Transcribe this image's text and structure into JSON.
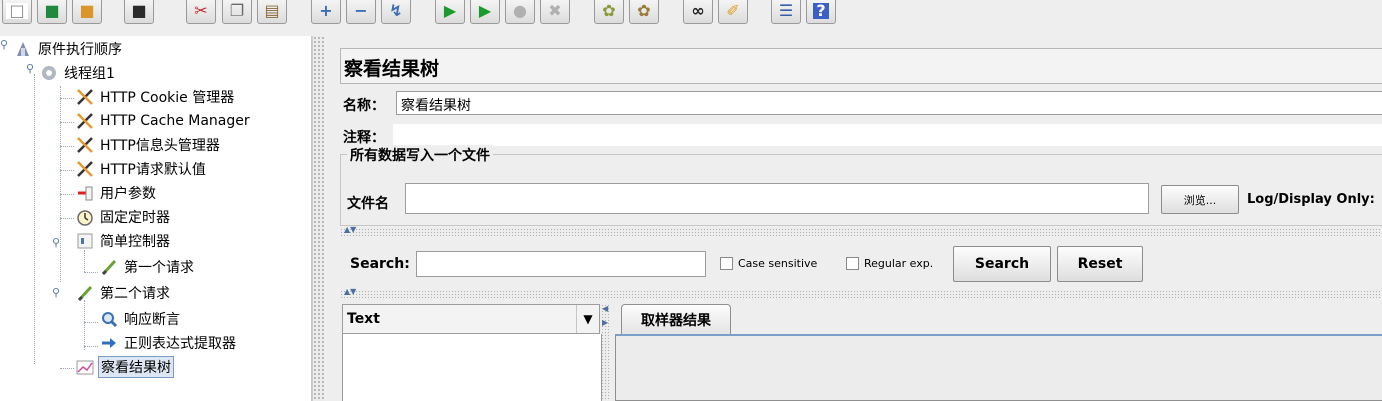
{
  "toolbar": {
    "buttons": [
      {
        "name": "new-icon",
        "glyph": "□",
        "color": "#ffffff"
      },
      {
        "name": "templates-icon",
        "glyph": "■",
        "color": "#1f8a3c"
      },
      {
        "name": "open-icon",
        "glyph": "■",
        "color": "#d9962a"
      },
      {
        "name": "save-icon",
        "glyph": "■",
        "color": "#2b2b2b"
      },
      {
        "name": "cut-icon",
        "glyph": "✂",
        "color": "#c0262c"
      },
      {
        "name": "copy-icon",
        "glyph": "❐",
        "color": "#6a6a6a"
      },
      {
        "name": "paste-icon",
        "glyph": "▤",
        "color": "#8a6a3a"
      },
      {
        "name": "expand-icon",
        "glyph": "+",
        "color": "#3a6fb5"
      },
      {
        "name": "collapse-icon",
        "glyph": "−",
        "color": "#3a6fb5"
      },
      {
        "name": "toggle-icon",
        "glyph": "↯",
        "color": "#3a6fb5"
      },
      {
        "name": "start-icon",
        "glyph": "▶",
        "color": "#1c9a2d"
      },
      {
        "name": "start-no-pause-icon",
        "glyph": "▶",
        "color": "#1c9a2d"
      },
      {
        "name": "stop-icon",
        "glyph": "●",
        "color": "#b0b0b0"
      },
      {
        "name": "shutdown-icon",
        "glyph": "✖",
        "color": "#b0b0b0"
      },
      {
        "name": "clear-icon",
        "glyph": "✿",
        "color": "#8a9a3a"
      },
      {
        "name": "clear-all-icon",
        "glyph": "✿",
        "color": "#9a7a3a"
      },
      {
        "name": "search-icon",
        "glyph": "∞",
        "color": "#222222"
      },
      {
        "name": "reset-search-icon",
        "glyph": "✐",
        "color": "#e0a020"
      },
      {
        "name": "function-helper-icon",
        "glyph": "☰",
        "color": "#3a5fa5"
      },
      {
        "name": "help-icon",
        "glyph": "?",
        "color": "#ffffff"
      }
    ]
  },
  "tree": {
    "nodes": [
      {
        "label": "原件执行顺序",
        "icon": "test-plan-icon"
      },
      {
        "label": "线程组1",
        "icon": "thread-group-icon"
      },
      {
        "label": "HTTP Cookie 管理器",
        "icon": "config-tool-icon"
      },
      {
        "label": "HTTP Cache Manager",
        "icon": "config-tool-icon"
      },
      {
        "label": "HTTP信息头管理器",
        "icon": "config-tool-icon"
      },
      {
        "label": "HTTP请求默认值",
        "icon": "config-tool-icon"
      },
      {
        "label": "用户参数",
        "icon": "pre-processor-icon"
      },
      {
        "label": "固定定时器",
        "icon": "timer-icon"
      },
      {
        "label": "简单控制器",
        "icon": "controller-icon"
      },
      {
        "label": "第一个请求",
        "icon": "sampler-icon"
      },
      {
        "label": "第二个请求",
        "icon": "sampler-icon"
      },
      {
        "label": "响应断言",
        "icon": "assertion-icon"
      },
      {
        "label": "正则表达式提取器",
        "icon": "post-processor-icon"
      },
      {
        "label": "察看结果树",
        "icon": "listener-icon"
      }
    ]
  },
  "panel": {
    "title": "察看结果树",
    "name_label": "名称：",
    "name_value": "察看结果树",
    "comment_label": "注释：",
    "comment_value": "",
    "file_group_title": "所有数据写入一个文件",
    "file_label": "文件名",
    "file_value": "",
    "browse_button": "浏览...",
    "log_display_label": "Log/Display Only:"
  },
  "search": {
    "label": "Search:",
    "value": "",
    "case_sensitive": "Case sensitive",
    "regular_exp": "Regular exp.",
    "search_button": "Search",
    "reset_button": "Reset"
  },
  "results": {
    "renderer_selected": "Text",
    "tab_label": "取样器结果"
  }
}
